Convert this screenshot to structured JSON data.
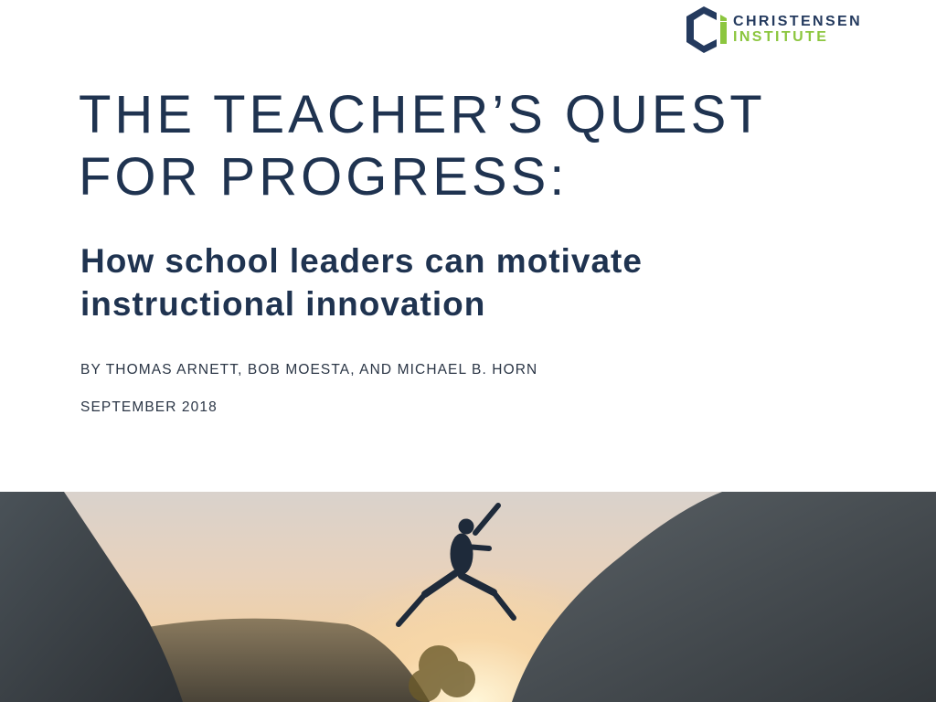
{
  "logo": {
    "line1": "CHRISTENSEN",
    "line2": "INSTITUTE",
    "colors": {
      "navy": "#243a5e",
      "green": "#8cc63f"
    }
  },
  "title": {
    "line1": "THE TEACHER’S QUEST",
    "line2": "FOR PROGRESS:"
  },
  "subtitle": {
    "line1": "How school leaders can motivate",
    "line2": "instructional innovation"
  },
  "authors": "BY THOMAS ARNETT, BOB MOESTA, AND MICHAEL B. HORN",
  "date": "SEPTEMBER 2018"
}
